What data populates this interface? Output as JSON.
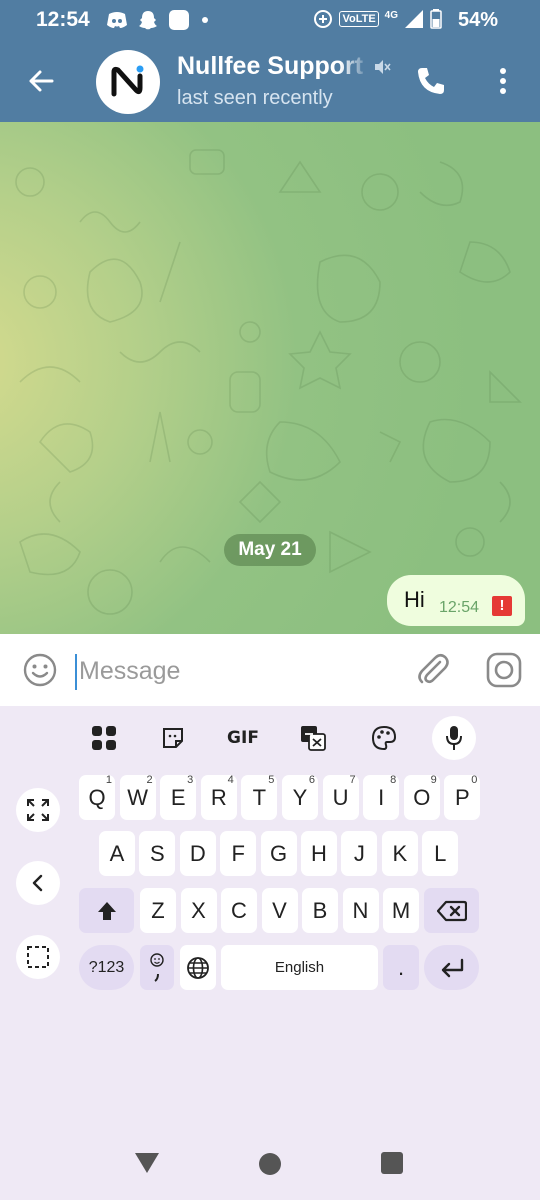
{
  "status_bar": {
    "time": "12:54",
    "battery_percent": "54%",
    "network_label": "4G",
    "volte_label": "VoLTE"
  },
  "header": {
    "title": "Nullfee Support",
    "subtitle": "last seen recently",
    "avatar_letter": "N",
    "brand_color": "#517da2"
  },
  "chat": {
    "date_label": "May 21",
    "messages": [
      {
        "text": "Hi",
        "time": "12:54",
        "status": "!"
      }
    ]
  },
  "composer": {
    "placeholder": "Message"
  },
  "keyboard": {
    "toolbar": {
      "gif_label": "GIF"
    },
    "row1": [
      {
        "label": "Q",
        "hint": "1"
      },
      {
        "label": "W",
        "hint": "2"
      },
      {
        "label": "E",
        "hint": "3"
      },
      {
        "label": "R",
        "hint": "4"
      },
      {
        "label": "T",
        "hint": "5"
      },
      {
        "label": "Y",
        "hint": "6"
      },
      {
        "label": "U",
        "hint": "7"
      },
      {
        "label": "I",
        "hint": "8"
      },
      {
        "label": "O",
        "hint": "9"
      },
      {
        "label": "P",
        "hint": "0"
      }
    ],
    "row2": [
      "A",
      "S",
      "D",
      "F",
      "G",
      "H",
      "J",
      "K",
      "L"
    ],
    "row3": [
      "Z",
      "X",
      "C",
      "V",
      "B",
      "N",
      "M"
    ],
    "symbols_label": "?123",
    "space_label": "English",
    "period_label": "."
  }
}
